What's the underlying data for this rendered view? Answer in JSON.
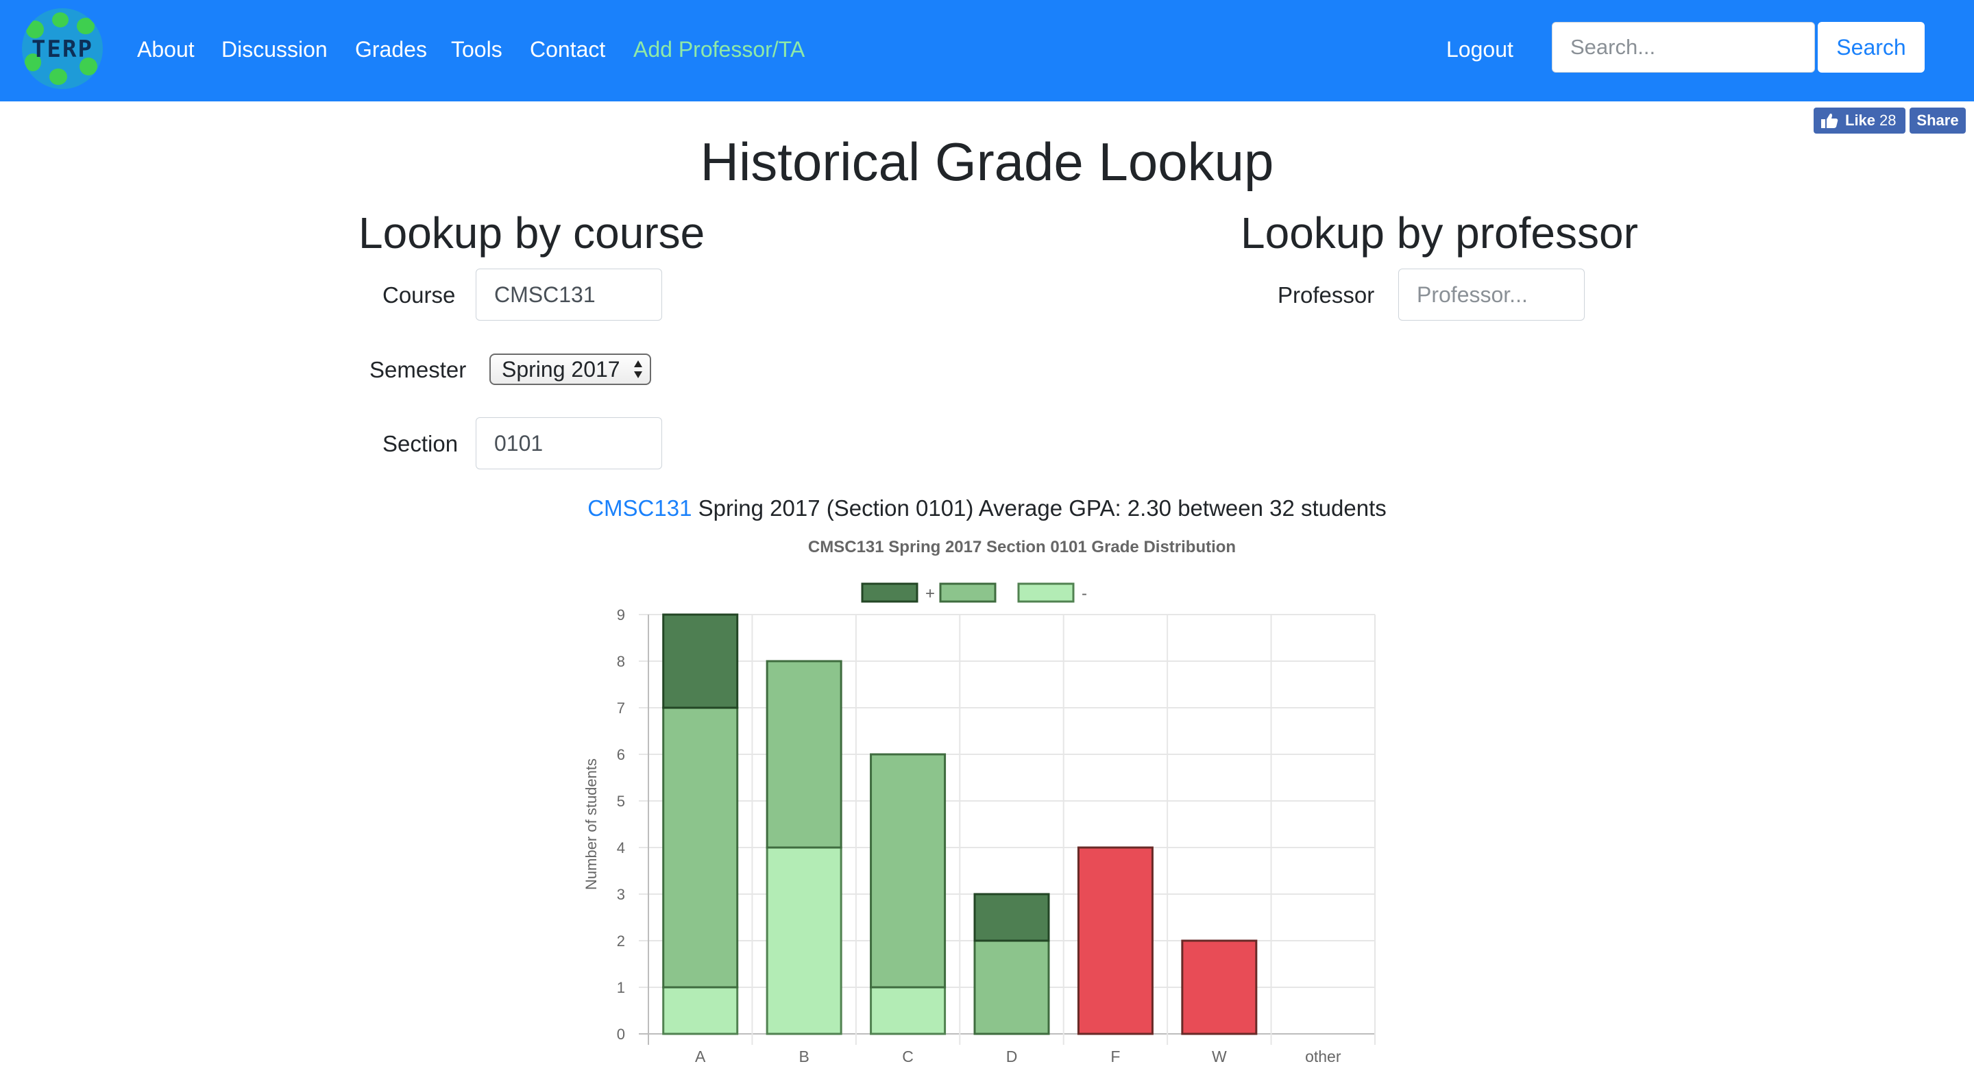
{
  "navbar": {
    "logo_text": "TERP",
    "links": [
      {
        "label": "About"
      },
      {
        "label": "Discussion"
      },
      {
        "label": "Grades"
      },
      {
        "label": "Tools"
      },
      {
        "label": "Contact"
      },
      {
        "label": "Add Professor/TA"
      }
    ],
    "logout_label": "Logout",
    "search_placeholder": "Search...",
    "search_button": "Search",
    "accent_color": "#8fe9a7",
    "bg_color": "#1a81fb"
  },
  "facebook": {
    "like_label": "Like",
    "like_count": "28",
    "share_label": "Share"
  },
  "page_title": "Historical Grade Lookup",
  "course_lookup": {
    "heading": "Lookup by course",
    "course_label": "Course",
    "course_value": "CMSC131",
    "semester_label": "Semester",
    "semester_value": "Spring 2017",
    "section_label": "Section",
    "section_value": "0101"
  },
  "professor_lookup": {
    "heading": "Lookup by professor",
    "professor_label": "Professor",
    "professor_placeholder": "Professor..."
  },
  "summary": {
    "course_link": "CMSC131",
    "text": " Spring 2017 (Section 0101) Average GPA: 2.30 between 32 students"
  },
  "chart_data": {
    "type": "bar",
    "stacked": true,
    "title": "CMSC131 Spring 2017 Section 0101 Grade Distribution",
    "xlabel": "",
    "ylabel": "Number of students",
    "categories": [
      "A",
      "B",
      "C",
      "D",
      "F",
      "W",
      "other"
    ],
    "ylim": [
      0,
      9
    ],
    "yticks": [
      0,
      1,
      2,
      3,
      4,
      5,
      6,
      7,
      8,
      9
    ],
    "grid": true,
    "legend_position": "top",
    "series": [
      {
        "name": "-",
        "color": "#b3ecb5",
        "values": [
          1,
          4,
          1,
          0,
          0,
          0,
          0
        ]
      },
      {
        "name": "",
        "color": "#8cc48c",
        "values": [
          6,
          4,
          5,
          2,
          0,
          0,
          0
        ]
      },
      {
        "name": "+",
        "color": "#4e7f52",
        "values": [
          2,
          0,
          0,
          1,
          0,
          0,
          0
        ]
      },
      {
        "name": "",
        "color": "#e84c56",
        "values": [
          0,
          0,
          0,
          0,
          4,
          2,
          0
        ]
      }
    ],
    "legend": [
      {
        "label": "+",
        "color": "#4e7f52"
      },
      {
        "label": "",
        "color": "#8cc48c"
      },
      {
        "label": "-",
        "color": "#b3ecb5"
      }
    ]
  }
}
